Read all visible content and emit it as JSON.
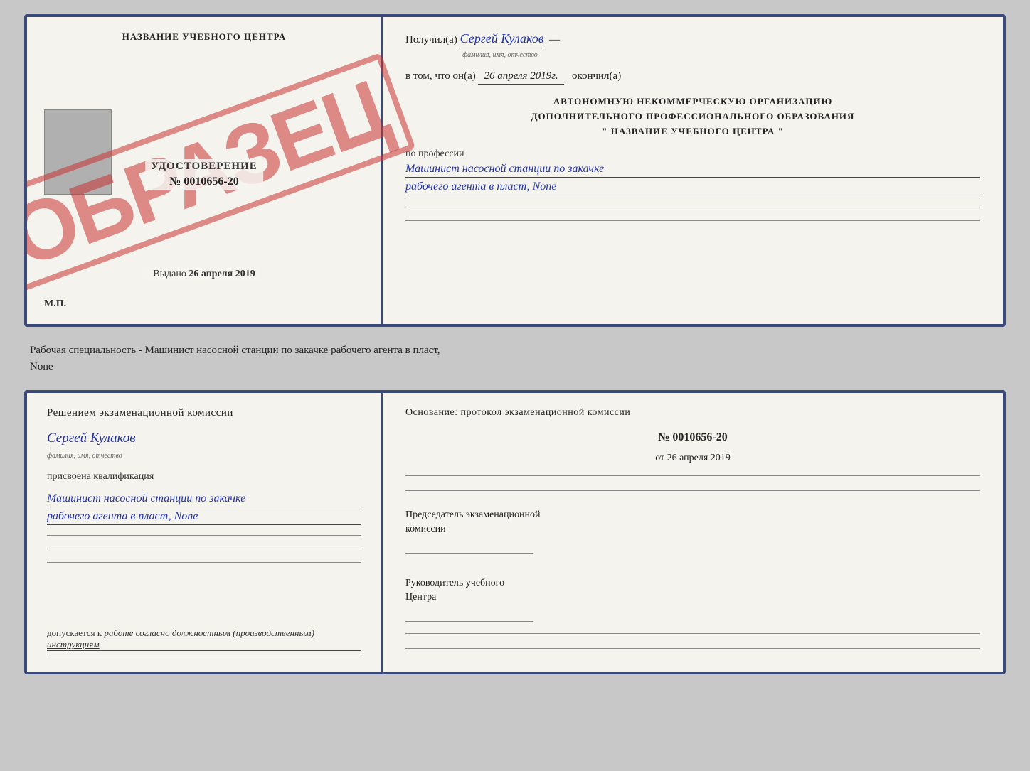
{
  "top_left": {
    "center_name": "НАЗВАНИЕ УЧЕБНОГО ЦЕНТРА",
    "stamp": "ОБРАЗЕЦ",
    "udostoverenie_title": "УДОСТОВЕРЕНИЕ",
    "udostoverenie_number": "№ 0010656-20",
    "vydano_prefix": "Выдано",
    "vydano_date": "26 апреля 2019",
    "mp_label": "М.П."
  },
  "top_right": {
    "recipient_prefix": "Получил(а)",
    "recipient_name": "Сергей Кулаков",
    "fio_sublabel": "фамилия, имя, отчество",
    "date_prefix": "в том, что он(а)",
    "date_value": "26 апреля 2019г.",
    "okoncil": "окончил(а)",
    "org_line1": "АВТОНОМНУЮ НЕКОММЕРЧЕСКУЮ ОРГАНИЗАЦИЮ",
    "org_line2": "ДОПОЛНИТЕЛЬНОГО ПРОФЕССИОНАЛЬНОГО ОБРАЗОВАНИЯ",
    "org_quote_open": "\"",
    "center_name_inner": "НАЗВАНИЕ УЧЕБНОГО ЦЕНТРА",
    "org_quote_close": "\"",
    "profession_label": "по профессии",
    "profession_line1": "Машинист насосной станции по закачке",
    "profession_line2": "рабочего агента в пласт, None"
  },
  "middle": {
    "text": "Рабочая специальность - Машинист насосной станции по закачке рабочего агента в пласт,",
    "text2": "None"
  },
  "bottom_left": {
    "komissia_text": "Решением экзаменационной комиссии",
    "person_name": "Сергей Кулаков",
    "fio_sublabel": "фамилия, имя, отчество",
    "kvali_label": "присвоена квалификация",
    "kvali_line1": "Машинист насосной станции по закачке",
    "kvali_line2": "рабочего агента в пласт, None",
    "dopuskaetsya_prefix": "допускается к",
    "dopuskaetsya_italic": "работе согласно должностным (производственным) инструкциям"
  },
  "bottom_right": {
    "osnovanye_label": "Основание: протокол экзаменационной комиссии",
    "protocol_number": "№ 0010656-20",
    "ot_prefix": "от",
    "ot_date": "26 апреля 2019",
    "chairman_label": "Председатель экзаменационной",
    "chairman_label2": "комиссии",
    "director_label": "Руководитель учебного",
    "director_label2": "Центра"
  }
}
